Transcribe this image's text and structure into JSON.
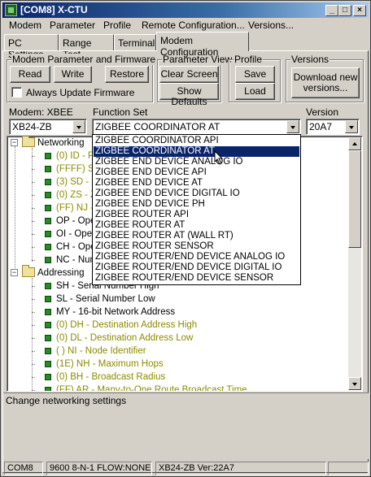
{
  "window": {
    "title": "[COM8] X-CTU",
    "min_glyph": "_",
    "max_glyph": "□",
    "close_glyph": "×"
  },
  "menu": [
    "Modem",
    "Parameter",
    "Profile",
    "Remote Configuration...",
    "Versions..."
  ],
  "tabs": [
    "PC Settings",
    "Range Test",
    "Terminal",
    "Modem Configuration"
  ],
  "active_tab": "Modem Configuration",
  "groups": {
    "param_firmware": {
      "label": "Modem Parameter and Firmware",
      "read": "Read",
      "write": "Write",
      "restore": "Restore",
      "always_update": "Always Update Firmware"
    },
    "param_view": {
      "label": "Parameter View",
      "clear": "Clear Screen",
      "defaults": "Show Defaults"
    },
    "profile": {
      "label": "Profile",
      "save": "Save",
      "load": "Load"
    },
    "versions": {
      "label": "Versions",
      "download": "Download new versions..."
    }
  },
  "selectors": {
    "modem_label": "Modem: XBEE",
    "modem_value": "XB24-ZB",
    "function_label": "Function Set",
    "function_value": "ZIGBEE COORDINATOR AT",
    "version_label": "Version",
    "version_value": "20A7"
  },
  "function_options": [
    "ZIGBEE COORDINATOR API",
    "ZIGBEE COORDINATOR AT",
    "ZIGBEE END DEVICE ANALOG IO",
    "ZIGBEE END DEVICE API",
    "ZIGBEE END DEVICE AT",
    "ZIGBEE END DEVICE DIGITAL IO",
    "ZIGBEE END DEVICE PH",
    "ZIGBEE ROUTER API",
    "ZIGBEE ROUTER AT",
    "ZIGBEE ROUTER AT (WALL RT)",
    "ZIGBEE ROUTER SENSOR",
    "ZIGBEE ROUTER/END DEVICE ANALOG IO",
    "ZIGBEE ROUTER/END DEVICE DIGITAL IO",
    "ZIGBEE ROUTER/END DEVICE SENSOR"
  ],
  "selected_option_index": 1,
  "tree": {
    "networking_label": "Networking",
    "networking_items": [
      {
        "text": "(0) ID - PA",
        "color": "olive"
      },
      {
        "text": "(FFFF) SC",
        "color": "olive"
      },
      {
        "text": "(3) SD - S",
        "color": "olive"
      },
      {
        "text": "(0) ZS - Z",
        "color": "olive"
      },
      {
        "text": "(FF) NJ - N",
        "color": "olive"
      },
      {
        "text": "OP - Oper",
        "color": "black"
      },
      {
        "text": "OI - Opera",
        "color": "black"
      },
      {
        "text": "CH - Oper",
        "color": "black"
      },
      {
        "text": "NC - Num",
        "color": "black"
      }
    ],
    "addressing_label": "Addressing",
    "addressing_items": [
      {
        "text": "SH - Serial Number High",
        "color": "black"
      },
      {
        "text": "SL - Serial Number Low",
        "color": "black"
      },
      {
        "text": "MY - 16-bit Network Address",
        "color": "black"
      },
      {
        "text": "(0) DH - Destination Address High",
        "color": "olive"
      },
      {
        "text": "(0) DL - Destination Address Low",
        "color": "olive"
      },
      {
        "text": "( ) NI - Node Identifier",
        "color": "olive"
      },
      {
        "text": "(1E) NH - Maximum Hops",
        "color": "olive"
      },
      {
        "text": "(0) BH - Broadcast Radius",
        "color": "olive"
      },
      {
        "text": "(FF) AR - Many-to-One Route Broadcast Time",
        "color": "olive"
      }
    ],
    "expander_minus": "−"
  },
  "description": "Change networking settings",
  "status": {
    "port": "COM8",
    "settings": "9600 8-N-1  FLOW:NONE",
    "model": "XB24-ZB  Ver:22A7"
  },
  "colors": {
    "olive": "#8b8b00",
    "selection": "#0a246a",
    "titlebar": "#0a246a"
  }
}
